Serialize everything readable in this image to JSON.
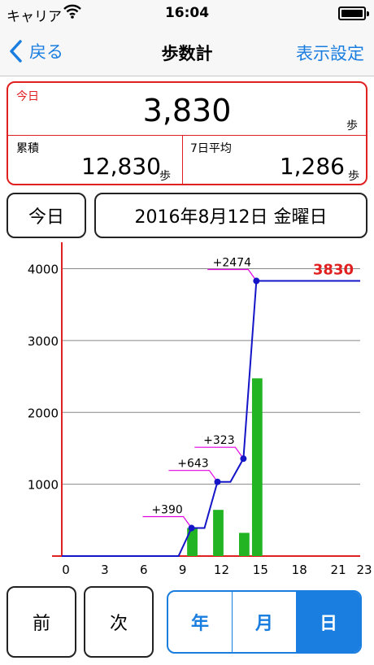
{
  "status_bar": {
    "carrier": "キャリア",
    "time": "16:04",
    "icons": [
      "wifi-icon",
      "battery-icon"
    ]
  },
  "nav": {
    "back_label": "戻る",
    "title": "歩数計",
    "settings_label": "表示設定"
  },
  "stats": {
    "today_label": "今日",
    "today_value": "3,830",
    "unit": "歩",
    "cumulative_label": "累積",
    "cumulative_value": "12,830",
    "avg_label": "7日平均",
    "avg_value": "1,286"
  },
  "controls": {
    "today_button": "今日",
    "date_display": "2016年8月12日 金曜日",
    "prev_button": "前",
    "next_button": "次"
  },
  "segments": {
    "items": [
      "年",
      "月",
      "日"
    ],
    "selected": "日"
  },
  "colors": {
    "accent": "#1a7de0",
    "red": "#e02020",
    "bar": "#22b422",
    "line": "#1515c8",
    "annotation": "#e000e0"
  },
  "chart_data": {
    "type": "bar",
    "x_ticks": [
      "0",
      "3",
      "6",
      "9",
      "12",
      "15",
      "18",
      "21",
      "23"
    ],
    "y_ticks": [
      "1000",
      "2000",
      "3000",
      "4000"
    ],
    "ylim": [
      0,
      4300
    ],
    "xlim": [
      0,
      23
    ],
    "hourly_bars": [
      {
        "hour": 10,
        "value": 390
      },
      {
        "hour": 12,
        "value": 643
      },
      {
        "hour": 14,
        "value": 323
      },
      {
        "hour": 15,
        "value": 2474
      }
    ],
    "cumulative_line": [
      [
        0,
        0
      ],
      [
        9,
        0
      ],
      [
        10,
        390
      ],
      [
        11,
        390
      ],
      [
        12,
        1033
      ],
      [
        13,
        1033
      ],
      [
        14,
        1356
      ],
      [
        15,
        3830
      ],
      [
        23,
        3830
      ]
    ],
    "annotations": [
      {
        "text": "+390",
        "hour": 10,
        "value": 390
      },
      {
        "text": "+643",
        "hour": 12,
        "value": 1033
      },
      {
        "text": "+323",
        "hour": 14,
        "value": 1356
      },
      {
        "text": "+2474",
        "hour": 15,
        "value": 3830
      }
    ],
    "total_label": "3830"
  }
}
